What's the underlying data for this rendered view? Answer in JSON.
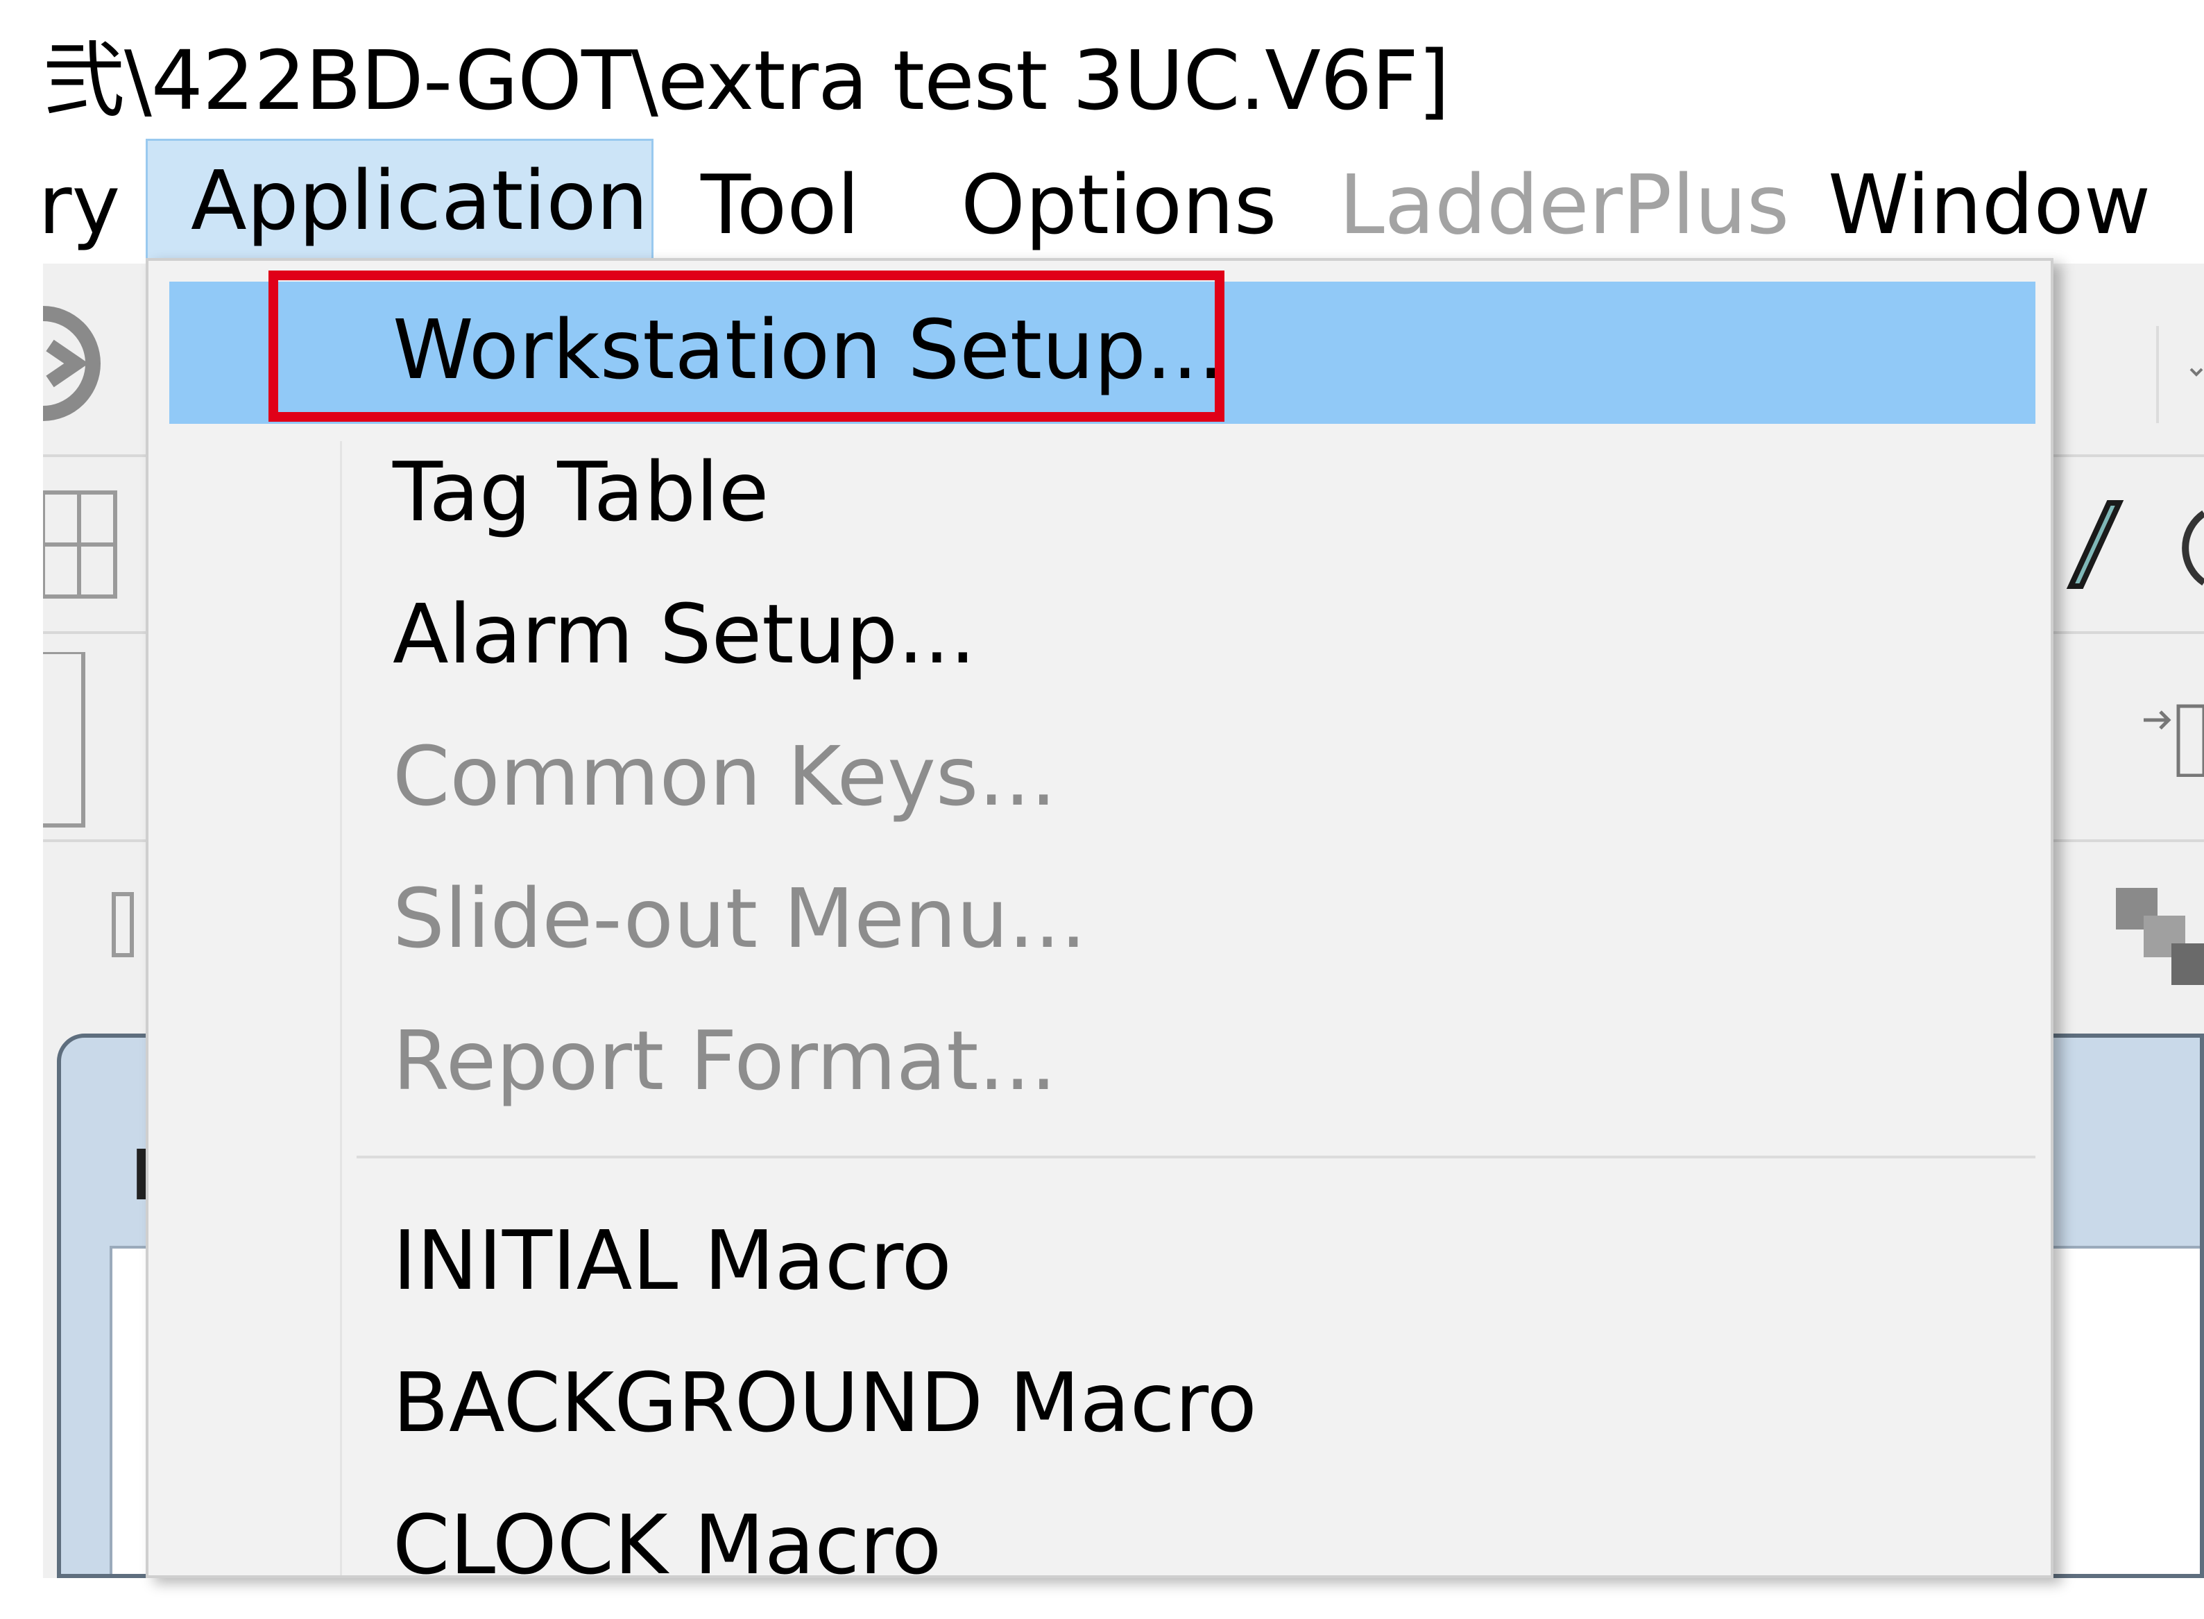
{
  "window": {
    "title": "弐\\422BD-GOT\\extra test 3UC.V6F]"
  },
  "menubar": {
    "items": [
      {
        "label": "ry",
        "enabled": true
      },
      {
        "label": "Application",
        "enabled": true,
        "active": true
      },
      {
        "label": "Tool",
        "enabled": true
      },
      {
        "label": "Options",
        "enabled": true
      },
      {
        "label": "LadderPlus",
        "enabled": false
      },
      {
        "label": "Window",
        "enabled": true
      }
    ]
  },
  "application_menu": {
    "items": [
      {
        "label": "Workstation Setup...",
        "enabled": true,
        "selected": true
      },
      {
        "label": "Tag Table",
        "enabled": true
      },
      {
        "label": "Alarm Setup...",
        "enabled": true
      },
      {
        "label": "Common Keys...",
        "enabled": false
      },
      {
        "label": "Slide-out Menu...",
        "enabled": false
      },
      {
        "label": "Report Format...",
        "enabled": false
      },
      {
        "label": "INITIAL Macro",
        "enabled": true
      },
      {
        "label": "BACKGROUND Macro",
        "enabled": true
      },
      {
        "label": "CLOCK Macro",
        "enabled": true
      }
    ]
  },
  "annotation": {
    "color": "#e00018"
  },
  "colors": {
    "selected_bg": "#91c9f7",
    "menu_active_bg": "#cce4f7",
    "disabled_text": "#8d8d8d"
  }
}
